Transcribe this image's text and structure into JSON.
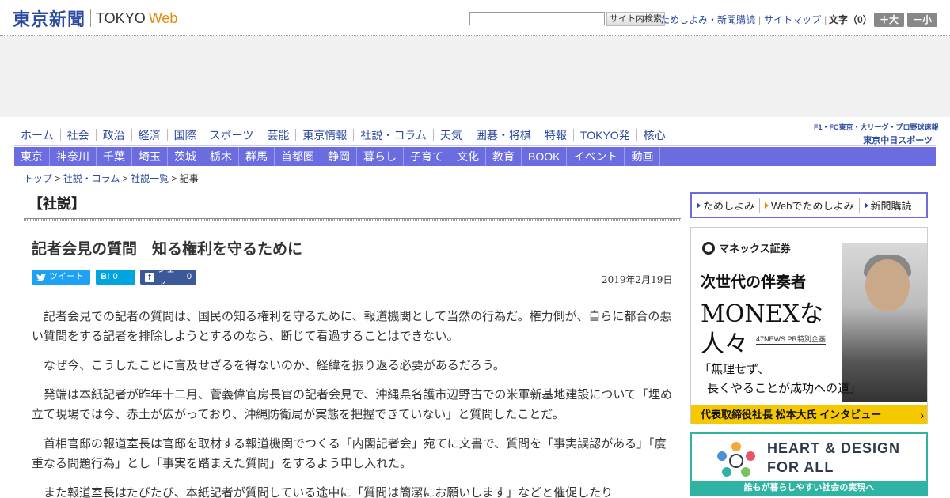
{
  "header": {
    "logo_ja": "東京新聞",
    "logo_tokyo": "TOKYO",
    "logo_web": "Web",
    "search_button": "サイト内検索",
    "links": [
      "ためしよみ・新聞購読",
      "サイトマップ"
    ],
    "fontsize_label": "文字（0）",
    "font_increase": "＋大",
    "font_decrease": "－小"
  },
  "nav_primary": [
    "ホーム",
    "社会",
    "政治",
    "経済",
    "国際",
    "スポーツ",
    "芸能",
    "東京情報",
    "社説・コラム",
    "天気",
    "囲碁・将棋",
    "特報",
    "TOKYO発",
    "核心"
  ],
  "sports_banner": {
    "line1": "F1・FC東京・大リーグ・プロ野球速報",
    "line2": "東京中日スポーツ"
  },
  "nav_regional": [
    "東京",
    "神奈川",
    "千葉",
    "埼玉",
    "茨城",
    "栃木",
    "群馬",
    "首都圏",
    "静岡",
    "暮らし",
    "子育て",
    "文化",
    "教育",
    "BOOK",
    "イベント",
    "動画"
  ],
  "breadcrumb": {
    "items": [
      "トップ",
      "社説・コラム",
      "社説一覧"
    ],
    "separator": ">",
    "current": "記事"
  },
  "article": {
    "section": "【社説】",
    "title": "記者会見の質問　知る権利を守るために",
    "share_twitter": "ツイート",
    "share_hatena": "B!",
    "hatena_count": "0",
    "share_facebook": "シェア",
    "facebook_count": "0",
    "date": "2019年2月19日",
    "paragraphs": [
      "記者会見での記者の質問は、国民の知る権利を守るために、報道機関として当然の行為だ。権力側が、自らに都合の悪い質問をする記者を排除しようとするのなら、断じて看過することはできない。",
      "なぜ今、こうしたことに言及せざるを得ないのか、経緯を振り返る必要があるだろう。",
      "発端は本紙記者が昨年十二月、菅義偉官房長官の記者会見で、沖縄県名護市辺野古での米軍新基地建設について「埋め立て現場では今、赤土が広がっており、沖縄防衛局が実態を把握できていない」と質問したことだ。",
      "首相官邸の報道室長は官邸を取材する報道機関でつくる「内閣記者会」宛てに文書で、質問を「事実誤認がある」「度重なる問題行為」とし「事実を踏まえた質問」をするよう申し入れた。",
      "また報道室長はたびたび、本紙記者が質問している途中に「質問は簡潔にお願いします」などと催促したり"
    ]
  },
  "sidebar": {
    "subscribe_links": [
      "ためしよみ",
      "Webでためしよみ",
      "新聞購読"
    ],
    "monex_ad": {
      "brand": "マネックス証券",
      "line1": "次世代の伴奏者",
      "line2": "MONEXな",
      "line3": "人々",
      "pr_label": "47NEWS PR特別企画",
      "quote1": "「無理せず、",
      "quote2": "長くやることが成功への道」",
      "bar_text": "代表取締役社長",
      "bar_name": "松本大氏 インタビュー",
      "bar_arrow": "›"
    },
    "heart_ad": {
      "line1": "HEART & DESIGN",
      "line2": "FOR ALL",
      "band": "誰もが暮らしやすい社会の実現へ"
    }
  },
  "colors": {
    "brand_blue": "#2b4aa0",
    "nav_band": "#6a6ce0",
    "web_orange": "#e8890c",
    "twitter": "#1da1f2",
    "hatena": "#00a4de",
    "facebook": "#3b5998",
    "monex_yellow": "#f5c800",
    "heart_teal": "#2fb3a2"
  }
}
